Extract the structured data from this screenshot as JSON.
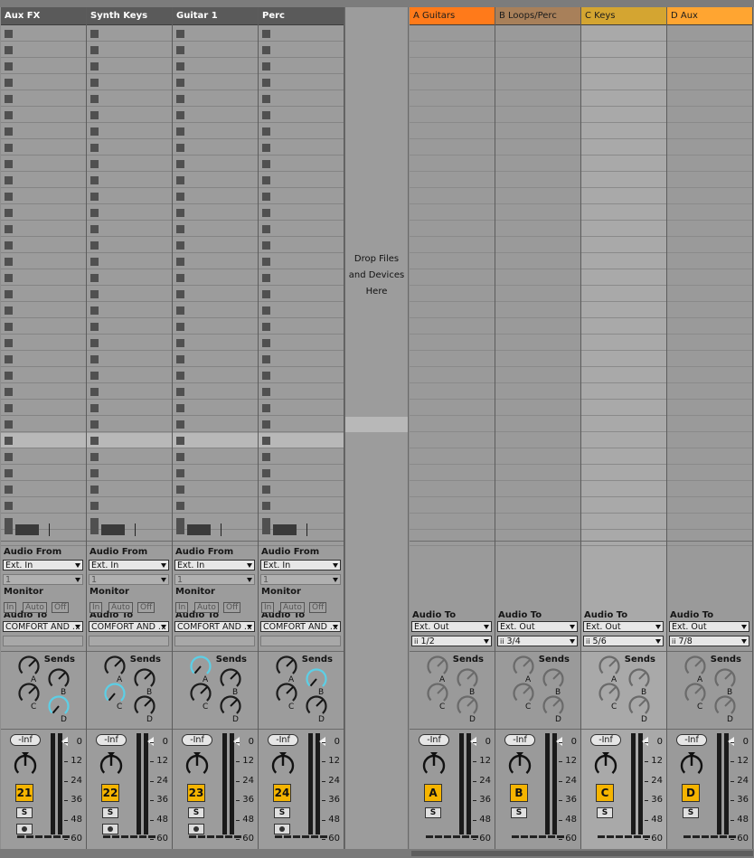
{
  "tracks": [
    {
      "name": "Aux FX",
      "audio_from": "Ext. In",
      "input_channel": "1",
      "audio_to": "COMFORT AND ...",
      "volume": "-Inf",
      "number": "21",
      "solo": "S",
      "send_highlight": 3
    },
    {
      "name": "Synth Keys",
      "audio_from": "Ext. In",
      "input_channel": "1",
      "audio_to": "COMFORT AND ...",
      "volume": "-Inf",
      "number": "22",
      "solo": "S",
      "send_highlight": 2
    },
    {
      "name": "Guitar 1",
      "audio_from": "Ext. In",
      "input_channel": "1",
      "audio_to": "COMFORT AND ...",
      "volume": "-Inf",
      "number": "23",
      "solo": "S",
      "send_highlight": 0
    },
    {
      "name": "Perc",
      "audio_from": "Ext. In",
      "input_channel": "1",
      "audio_to": "COMFORT AND ...",
      "volume": "-Inf",
      "number": "24",
      "solo": "S",
      "send_highlight": 1
    }
  ],
  "returns": [
    {
      "name": "A Guitars",
      "color": "#ff7a1a",
      "audio_to": "Ext. Out",
      "output_channel": "1/2",
      "volume": "-Inf",
      "letter": "A",
      "solo": "S",
      "light": false
    },
    {
      "name": "B Loops/Perc",
      "color": "#a8805a",
      "audio_to": "Ext. Out",
      "output_channel": "3/4",
      "volume": "-Inf",
      "letter": "B",
      "solo": "S",
      "light": false
    },
    {
      "name": "C Keys",
      "color": "#d4a531",
      "audio_to": "Ext. Out",
      "output_channel": "5/6",
      "volume": "-Inf",
      "letter": "C",
      "solo": "S",
      "light": true
    },
    {
      "name": "D Aux",
      "color": "#ffa531",
      "audio_to": "Ext. Out",
      "output_channel": "7/8",
      "volume": "-Inf",
      "letter": "D",
      "solo": "S",
      "light": false
    }
  ],
  "labels": {
    "audio_from": "Audio From",
    "audio_to": "Audio To",
    "monitor": "Monitor",
    "monitor_in": "In",
    "monitor_auto": "Auto",
    "monitor_off": "Off",
    "sends": "Sends",
    "send_letters": [
      "A",
      "B",
      "C",
      "D"
    ],
    "meter_scale": [
      "0",
      "12",
      "24",
      "36",
      "48",
      "60"
    ],
    "channel_icon": "ii"
  },
  "drop_zone": {
    "line1": "Drop Files",
    "line2": "and Devices",
    "line3": "Here"
  },
  "colors": {
    "send_highlight": "#5ccfe6",
    "number_badge": "#f5b400"
  }
}
